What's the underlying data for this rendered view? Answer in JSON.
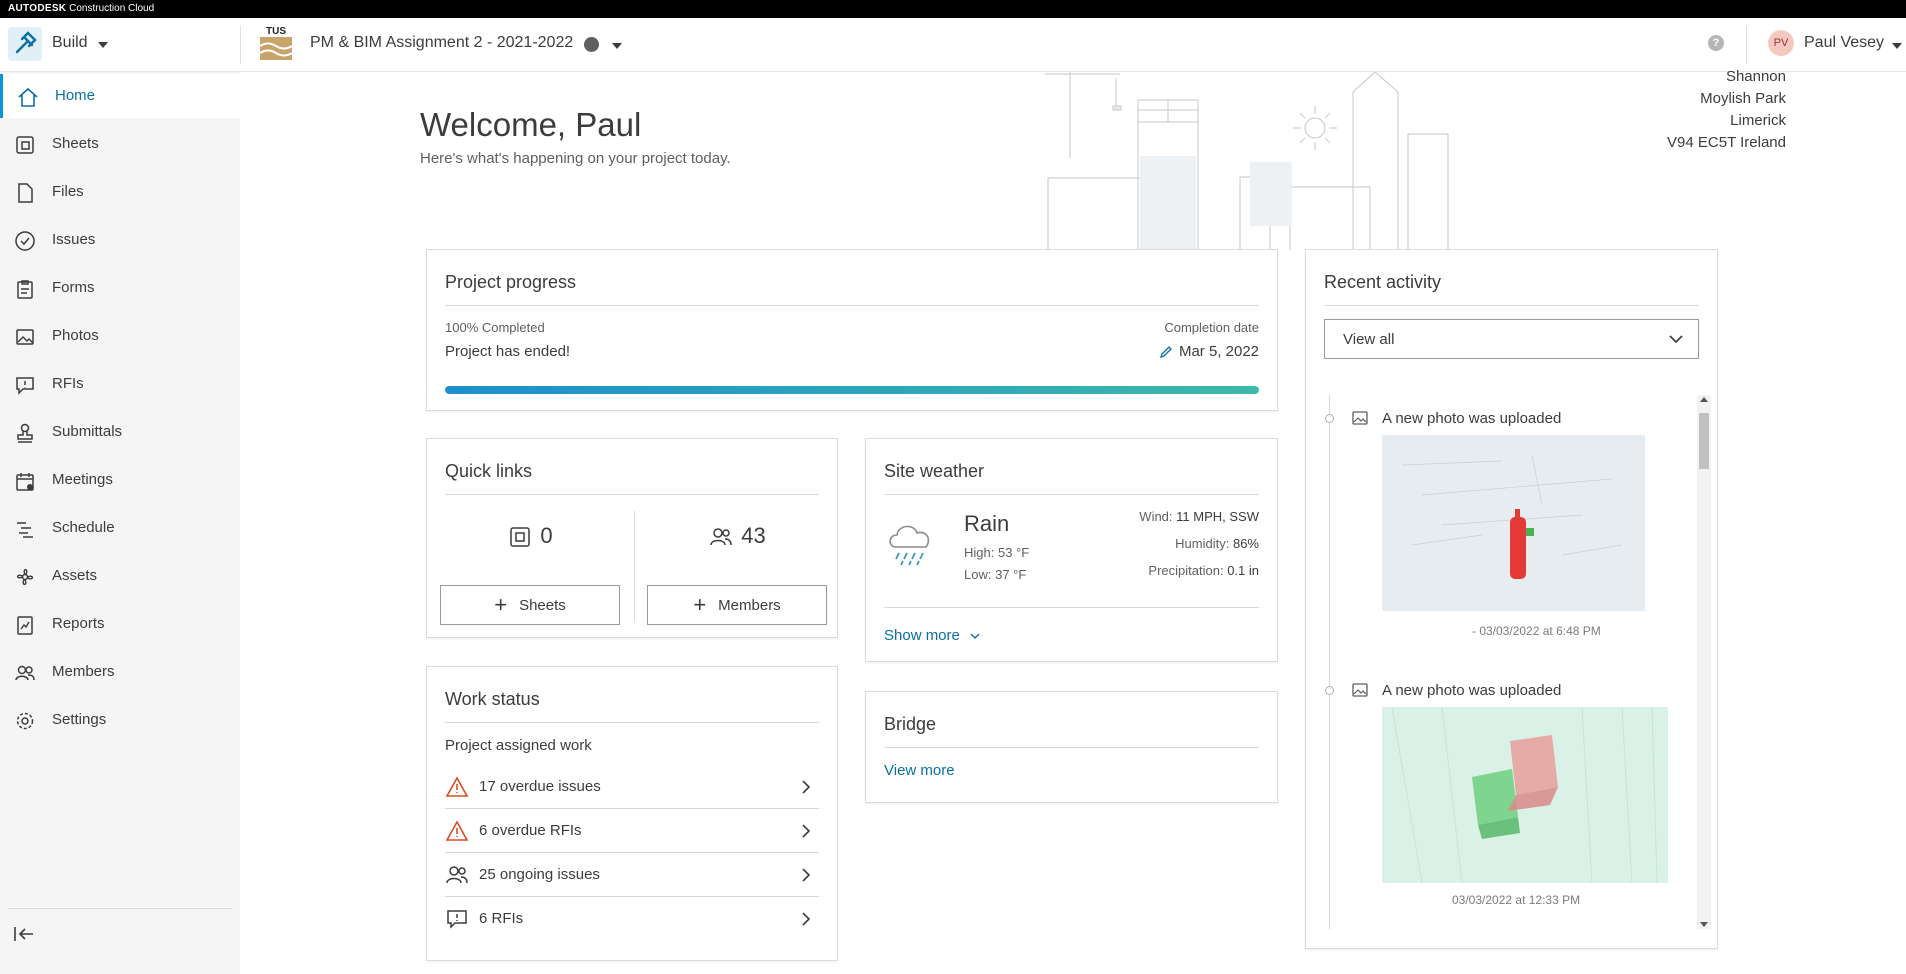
{
  "brand": {
    "company": "AUTODESK",
    "product": "Construction Cloud"
  },
  "header": {
    "module": "Build",
    "project_title": "PM & BIM Assignment 2 - 2021-2022",
    "project_logo_text": "TUS",
    "help_symbol": "?",
    "user_initials": "PV",
    "user_name": "Paul Vesey"
  },
  "sidebar": {
    "items": [
      {
        "label": "Home",
        "icon": "home-icon"
      },
      {
        "label": "Sheets",
        "icon": "sheets-icon"
      },
      {
        "label": "Files",
        "icon": "file-icon"
      },
      {
        "label": "Issues",
        "icon": "check-circle-icon"
      },
      {
        "label": "Forms",
        "icon": "clipboard-icon"
      },
      {
        "label": "Photos",
        "icon": "photo-icon"
      },
      {
        "label": "RFIs",
        "icon": "rfi-icon"
      },
      {
        "label": "Submittals",
        "icon": "stamp-icon"
      },
      {
        "label": "Meetings",
        "icon": "calendar-icon"
      },
      {
        "label": "Schedule",
        "icon": "schedule-icon"
      },
      {
        "label": "Assets",
        "icon": "fan-icon"
      },
      {
        "label": "Reports",
        "icon": "report-icon"
      },
      {
        "label": "Members",
        "icon": "members-icon"
      },
      {
        "label": "Settings",
        "icon": "gear-icon"
      }
    ],
    "active": "Home"
  },
  "main": {
    "welcome": "Welcome, Paul",
    "welcome_sub": "Here's what's happening on your project today.",
    "address": [
      "Shannon",
      "Moylish Park",
      "Limerick",
      "V94 EC5T Ireland"
    ]
  },
  "progress": {
    "title": "Project progress",
    "percent_label": "100% Completed",
    "percent": 100,
    "status": "Project has ended!",
    "completion_label": "Completion date",
    "completion_date": "Mar 5, 2022"
  },
  "quick_links": {
    "title": "Quick links",
    "sheets_count": "0",
    "members_count": "43",
    "sheets_button": "Sheets",
    "members_button": "Members"
  },
  "weather": {
    "title": "Site weather",
    "condition": "Rain",
    "high_label": "High:",
    "high": "53 °F",
    "low_label": "Low:",
    "low": "37 °F",
    "wind_label": "Wind:",
    "wind": "11 MPH, SSW",
    "humidity_label": "Humidity:",
    "humidity": "86%",
    "precip_label": "Precipitation:",
    "precip": "0.1 in",
    "show_more": "Show more"
  },
  "bridge": {
    "title": "Bridge",
    "view_more": "View more"
  },
  "work_status": {
    "title": "Work status",
    "subtitle": "Project assigned work",
    "rows": [
      {
        "label": "17 overdue issues",
        "icon": "warning-icon"
      },
      {
        "label": "6 overdue RFIs",
        "icon": "warning-icon"
      },
      {
        "label": "25 ongoing issues",
        "icon": "members-icon"
      },
      {
        "label": "6 RFIs",
        "icon": "rfi-icon"
      }
    ]
  },
  "recent_activity": {
    "title": "Recent activity",
    "filter": "View all",
    "items": [
      {
        "text": "A new photo was uploaded",
        "time": "- 03/03/2022 at 6:48 PM"
      },
      {
        "text": "A new photo was uploaded",
        "time": "03/03/2022 at 12:33 PM"
      }
    ]
  },
  "colors": {
    "accent": "#0696d7",
    "link": "#0b6fa4",
    "warning": "#d74e26"
  }
}
